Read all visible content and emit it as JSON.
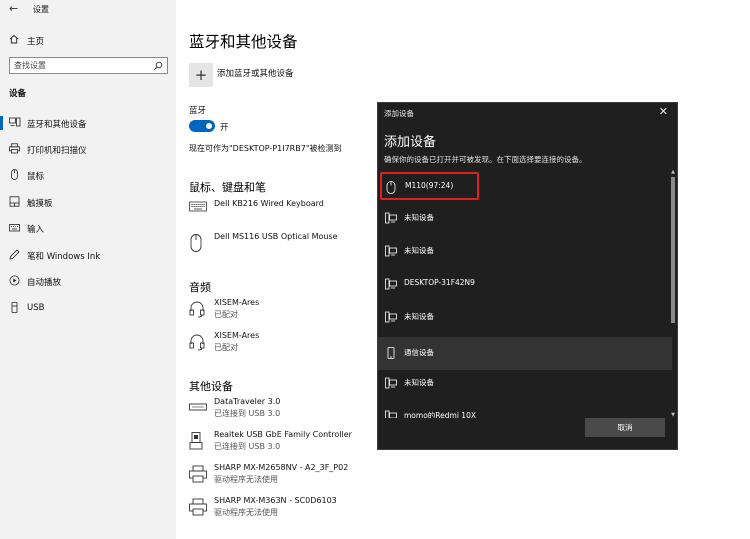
{
  "app": {
    "title": "设置",
    "back_icon": "back-arrow-icon"
  },
  "sidebar": {
    "home": "主页",
    "search_placeholder": "查找设置",
    "section": "设备",
    "items": [
      {
        "label": "蓝牙和其他设备",
        "icon": "bluetooth-devices-icon",
        "active": true
      },
      {
        "label": "打印机和扫描仪",
        "icon": "printer-icon"
      },
      {
        "label": "鼠标",
        "icon": "mouse-icon"
      },
      {
        "label": "触摸板",
        "icon": "touchpad-icon"
      },
      {
        "label": "输入",
        "icon": "keyboard-icon"
      },
      {
        "label": "笔和 Windows Ink",
        "icon": "pen-icon"
      },
      {
        "label": "自动播放",
        "icon": "autoplay-icon"
      },
      {
        "label": "USB",
        "icon": "usb-icon"
      }
    ]
  },
  "main": {
    "title": "蓝牙和其他设备",
    "add_device": "添加蓝牙或其他设备",
    "bluetooth_label": "蓝牙",
    "bluetooth_state": "开",
    "discoverable_text": "现在可作为\"DESKTOP-P1I7RB7\"被检测到",
    "groups": {
      "input": {
        "title": "鼠标、键盘和笔",
        "devices": [
          {
            "name": "Dell KB216 Wired Keyboard",
            "status": ""
          },
          {
            "name": "Dell MS116 USB Optical Mouse",
            "status": ""
          }
        ]
      },
      "audio": {
        "title": "音频",
        "devices": [
          {
            "name": "XISEM-Ares",
            "status": "已配对"
          },
          {
            "name": "XISEM-Ares",
            "status": "已配对"
          }
        ]
      },
      "other": {
        "title": "其他设备",
        "devices": [
          {
            "name": "DataTraveler 3.0",
            "status": "已连接到 USB 3.0"
          },
          {
            "name": "Realtek USB GbE Family Controller",
            "status": "已连接到 USB 3.0"
          },
          {
            "name": "SHARP MX-M2658NV - A2_3F_P02",
            "status": "驱动程序无法使用"
          },
          {
            "name": "SHARP MX-M363N - SC0D6103",
            "status": "驱动程序无法使用"
          }
        ]
      }
    }
  },
  "dialog": {
    "titlebar": "添加设备",
    "heading": "添加设备",
    "subtitle": "确保你的设备已打开并可被发现。在下面选择要连接的设备。",
    "items": [
      {
        "label": "M110(97:24)",
        "icon": "mouse-icon"
      },
      {
        "label": "未知设备",
        "icon": "computer-icon"
      },
      {
        "label": "未知设备",
        "icon": "computer-icon"
      },
      {
        "label": "DESKTOP-31F42N9",
        "icon": "computer-icon"
      },
      {
        "label": "未知设备",
        "icon": "computer-icon"
      },
      {
        "label": "通信设备",
        "icon": "phone-icon"
      },
      {
        "label": "未知设备",
        "icon": "computer-icon"
      },
      {
        "label": "momo的Redmi 10X",
        "icon": "computer-icon"
      }
    ],
    "cancel": "取消",
    "colors": {
      "background": "#1f1f1f",
      "selection_border": "#e02020",
      "hover": "#333333"
    }
  },
  "colors": {
    "accent": "#0067c0",
    "sidebar_bg": "#f2f2f2"
  }
}
